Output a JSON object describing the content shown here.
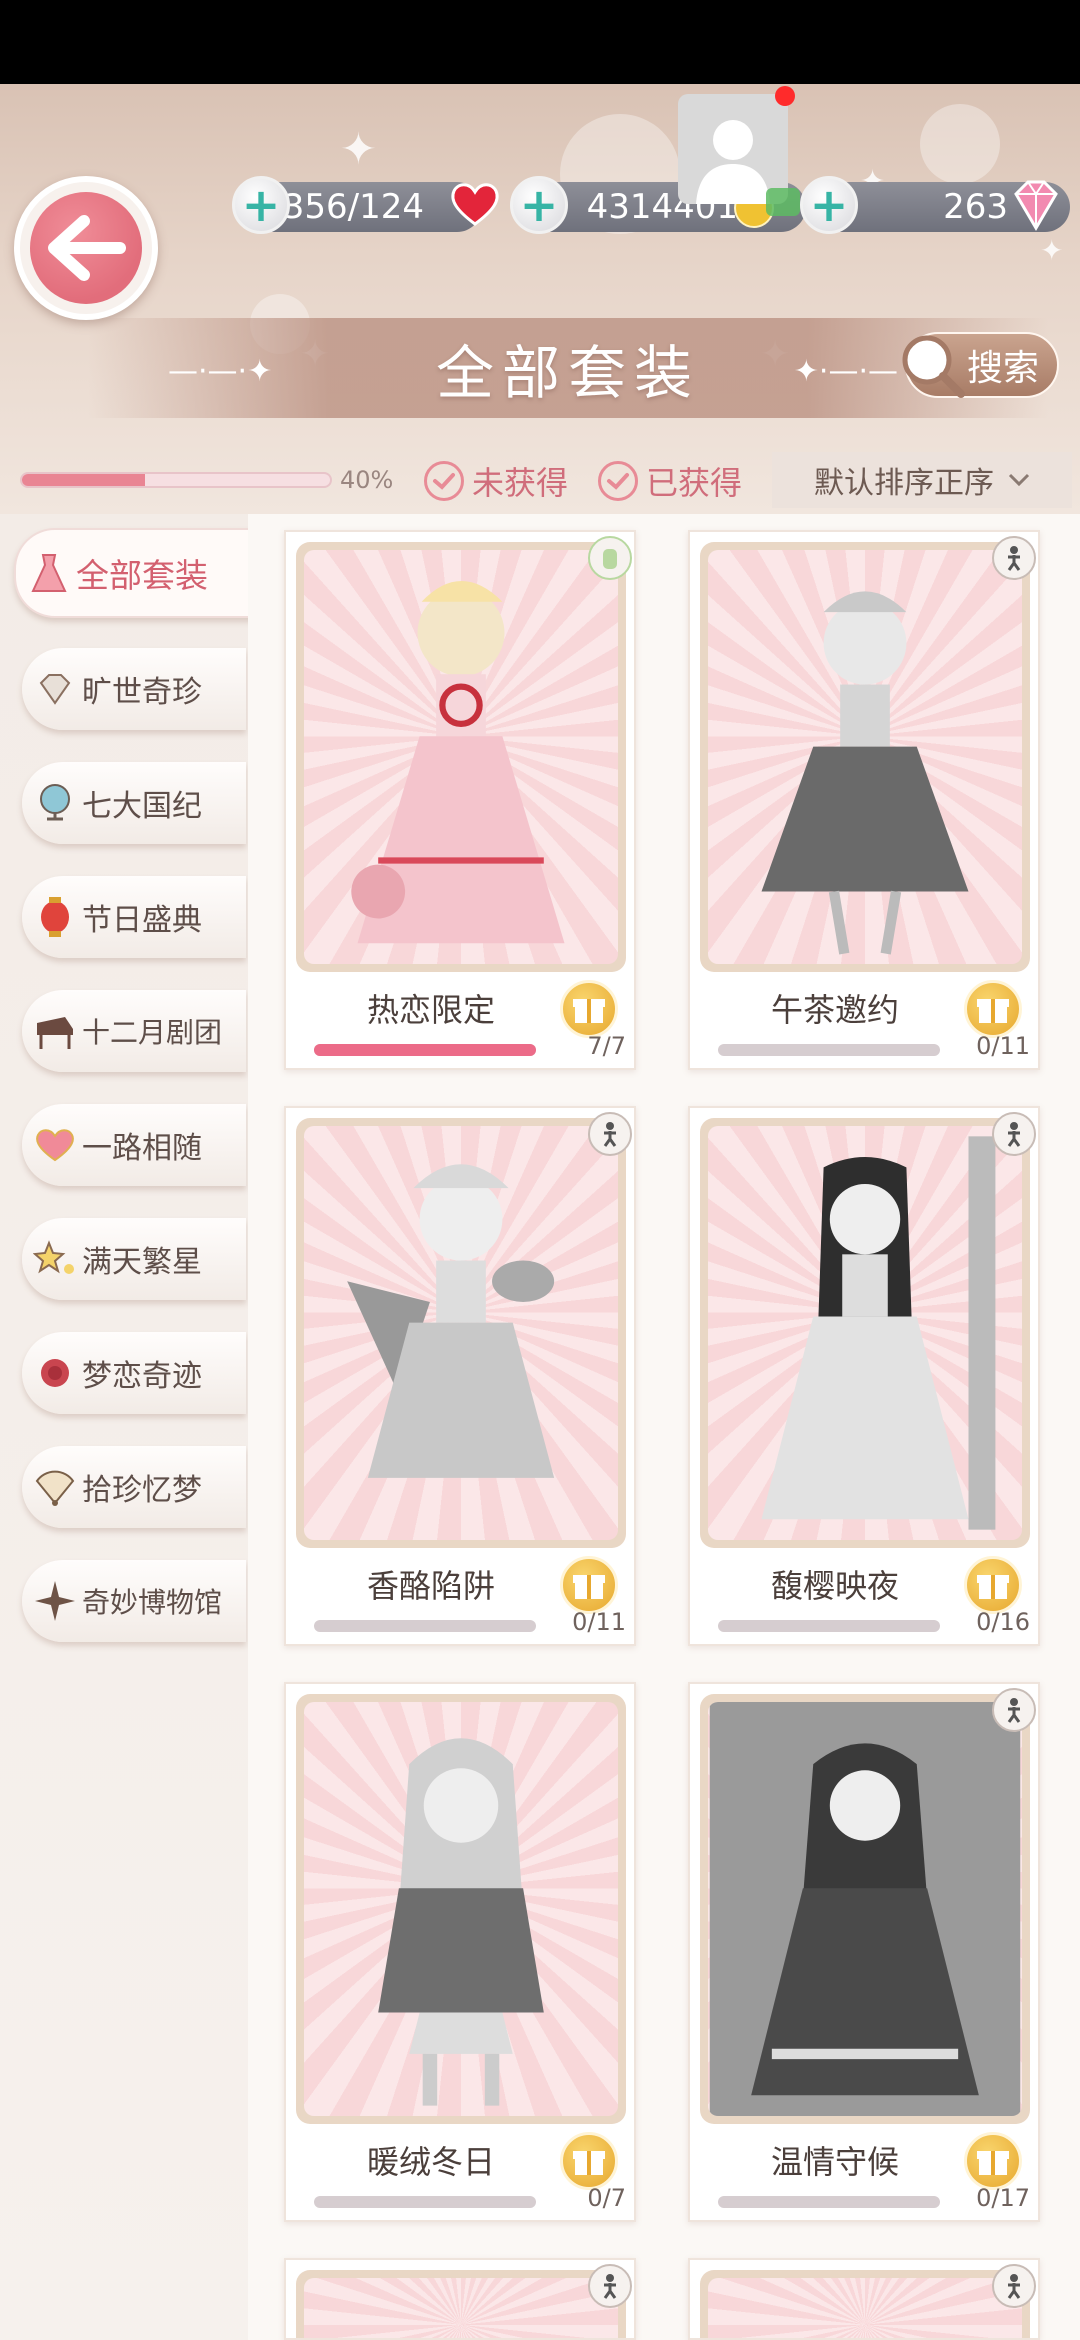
{
  "resources": {
    "stamina": "10356/124",
    "coins": "4314401",
    "diamonds": "263"
  },
  "header": {
    "title": "全部套装",
    "search_label": "搜索"
  },
  "filters": {
    "progress_label": "40%",
    "progress_value": 0.4,
    "not_obtained": "未获得",
    "obtained": "已获得",
    "sort_label": "默认排序正序"
  },
  "sidebar": {
    "items": [
      {
        "label": "全部套装",
        "icon": "dress-icon"
      },
      {
        "label": "旷世奇珍",
        "icon": "gem-icon"
      },
      {
        "label": "七大国纪",
        "icon": "globe-icon"
      },
      {
        "label": "节日盛典",
        "icon": "lantern-icon"
      },
      {
        "label": "十二月剧团",
        "icon": "piano-icon"
      },
      {
        "label": "一路相随",
        "icon": "heart-icon"
      },
      {
        "label": "满天繁星",
        "icon": "stars-icon"
      },
      {
        "label": "梦恋奇迹",
        "icon": "rose-icon"
      },
      {
        "label": "拾珍忆梦",
        "icon": "fan-icon"
      },
      {
        "label": "奇妙博物馆",
        "icon": "compass-icon"
      }
    ]
  },
  "suits": [
    {
      "name": "热恋限定",
      "count": "7/7",
      "progress": 1.0
    },
    {
      "name": "午茶邀约",
      "count": "0/11",
      "progress": 0
    },
    {
      "name": "香酪陷阱",
      "count": "0/11",
      "progress": 0
    },
    {
      "name": "馥樱映夜",
      "count": "0/16",
      "progress": 0
    },
    {
      "name": "暖绒冬日",
      "count": "0/7",
      "progress": 0
    },
    {
      "name": "温情守候",
      "count": "0/17",
      "progress": 0
    }
  ],
  "colors": {
    "accent_pink": "#e26d7b",
    "progress_pink": "#ec6b88",
    "gold": "#e7a82f",
    "resource_bar": "#7a7c86"
  }
}
